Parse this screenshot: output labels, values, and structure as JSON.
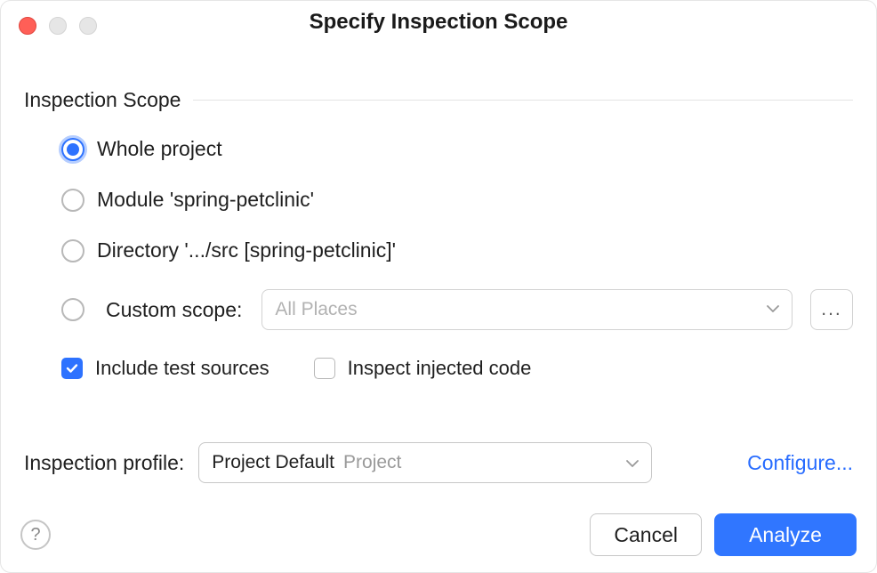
{
  "title": "Specify Inspection Scope",
  "section_label": "Inspection Scope",
  "scope_options": {
    "whole": "Whole project",
    "module": "Module 'spring-petclinic'",
    "directory": "Directory '.../src [spring-petclinic]'",
    "custom_label": "Custom scope:"
  },
  "custom_scope_value": "All Places",
  "ellipsis_label": "...",
  "checkboxes": {
    "include_tests": "Include test sources",
    "inspect_injected": "Inspect injected code"
  },
  "profile": {
    "label": "Inspection profile:",
    "value": "Project Default",
    "suffix": "Project",
    "configure": "Configure..."
  },
  "footer": {
    "help": "?",
    "cancel": "Cancel",
    "analyze": "Analyze"
  }
}
